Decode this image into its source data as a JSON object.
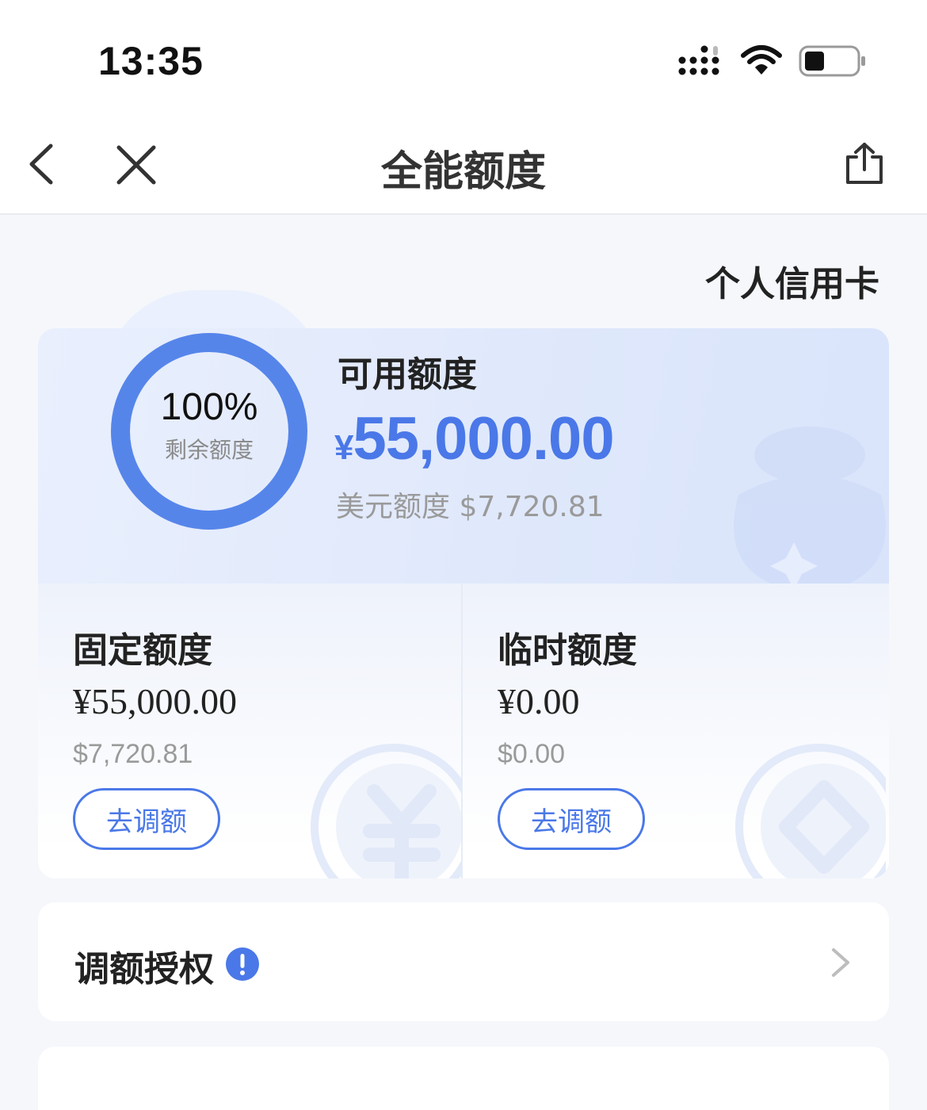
{
  "status_bar": {
    "time": "13:35",
    "icons": [
      "signal-icon",
      "wifi-icon",
      "battery-icon"
    ]
  },
  "nav": {
    "title": "全能额度",
    "icons": [
      "back-icon",
      "close-icon",
      "share-icon"
    ]
  },
  "card_type": "个人信用卡",
  "available": {
    "ring_percent": "100%",
    "ring_caption": "剩余额度",
    "ring_fill_fraction": 1.0,
    "label": "可用额度",
    "currency_symbol": "¥",
    "amount": "55,000.00",
    "usd_label": "美元额度 $7,720.81"
  },
  "fixed": {
    "label": "固定额度",
    "amount": "¥55,000.00",
    "usd": "$7,720.81",
    "button": "去调额"
  },
  "temporary": {
    "label": "临时额度",
    "amount": "¥0.00",
    "usd": "$0.00",
    "button": "去调额"
  },
  "auth_row": {
    "label": "调额授权",
    "icons": [
      "info-icon",
      "chevron-right-icon"
    ]
  },
  "colors": {
    "accent": "#4a78e8",
    "ring": "#5685ea",
    "background": "#f5f7fb"
  }
}
